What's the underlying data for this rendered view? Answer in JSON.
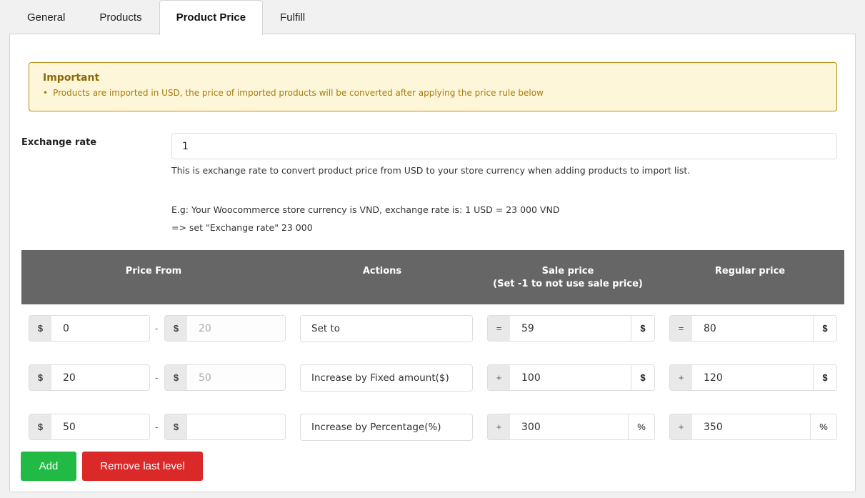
{
  "tabs": [
    {
      "label": "General",
      "active": false
    },
    {
      "label": "Products",
      "active": false
    },
    {
      "label": "Product Price",
      "active": true
    },
    {
      "label": "Fulfill",
      "active": false
    }
  ],
  "notice": {
    "title": "Important",
    "items": [
      "Products are imported in USD, the price of imported products will be converted after applying the price rule below"
    ]
  },
  "exchange_rate": {
    "label": "Exchange rate",
    "value": "1",
    "description": "This is exchange rate to convert product price from USD to your store currency when adding products to import list.",
    "example_line1": "E.g: Your Woocommerce store currency is VND, exchange rate is: 1 USD = 23 000 VND",
    "example_line2": "=> set \"Exchange rate\" 23 000"
  },
  "table": {
    "headers": {
      "price_from": "Price From",
      "actions": "Actions",
      "sale_price": "Sale price",
      "sale_price_note": "(Set -1 to not use sale price)",
      "regular_price": "Regular price"
    },
    "currency_symbol": "$",
    "range_separator": "-",
    "rows": [
      {
        "from": "0",
        "to": "20",
        "action": "Set to",
        "sale_op": "=",
        "sale_value": "59",
        "sale_unit": "$",
        "regular_op": "=",
        "regular_value": "80",
        "regular_unit": "$"
      },
      {
        "from": "20",
        "to": "50",
        "action": "Increase by Fixed amount($)",
        "sale_op": "+",
        "sale_value": "100",
        "sale_unit": "$",
        "regular_op": "+",
        "regular_value": "120",
        "regular_unit": "$"
      },
      {
        "from": "50",
        "to": "",
        "action": "Increase by Percentage(%)",
        "sale_op": "+",
        "sale_value": "300",
        "sale_unit": "%",
        "regular_op": "+",
        "regular_value": "350",
        "regular_unit": "%"
      }
    ]
  },
  "buttons": {
    "add": "Add",
    "remove_last": "Remove last level"
  },
  "colors": {
    "add_button": "#21ba45",
    "remove_button": "#db2828",
    "table_header": "#666666",
    "notice_bg": "#fef6d8",
    "notice_border": "#b88d19"
  }
}
